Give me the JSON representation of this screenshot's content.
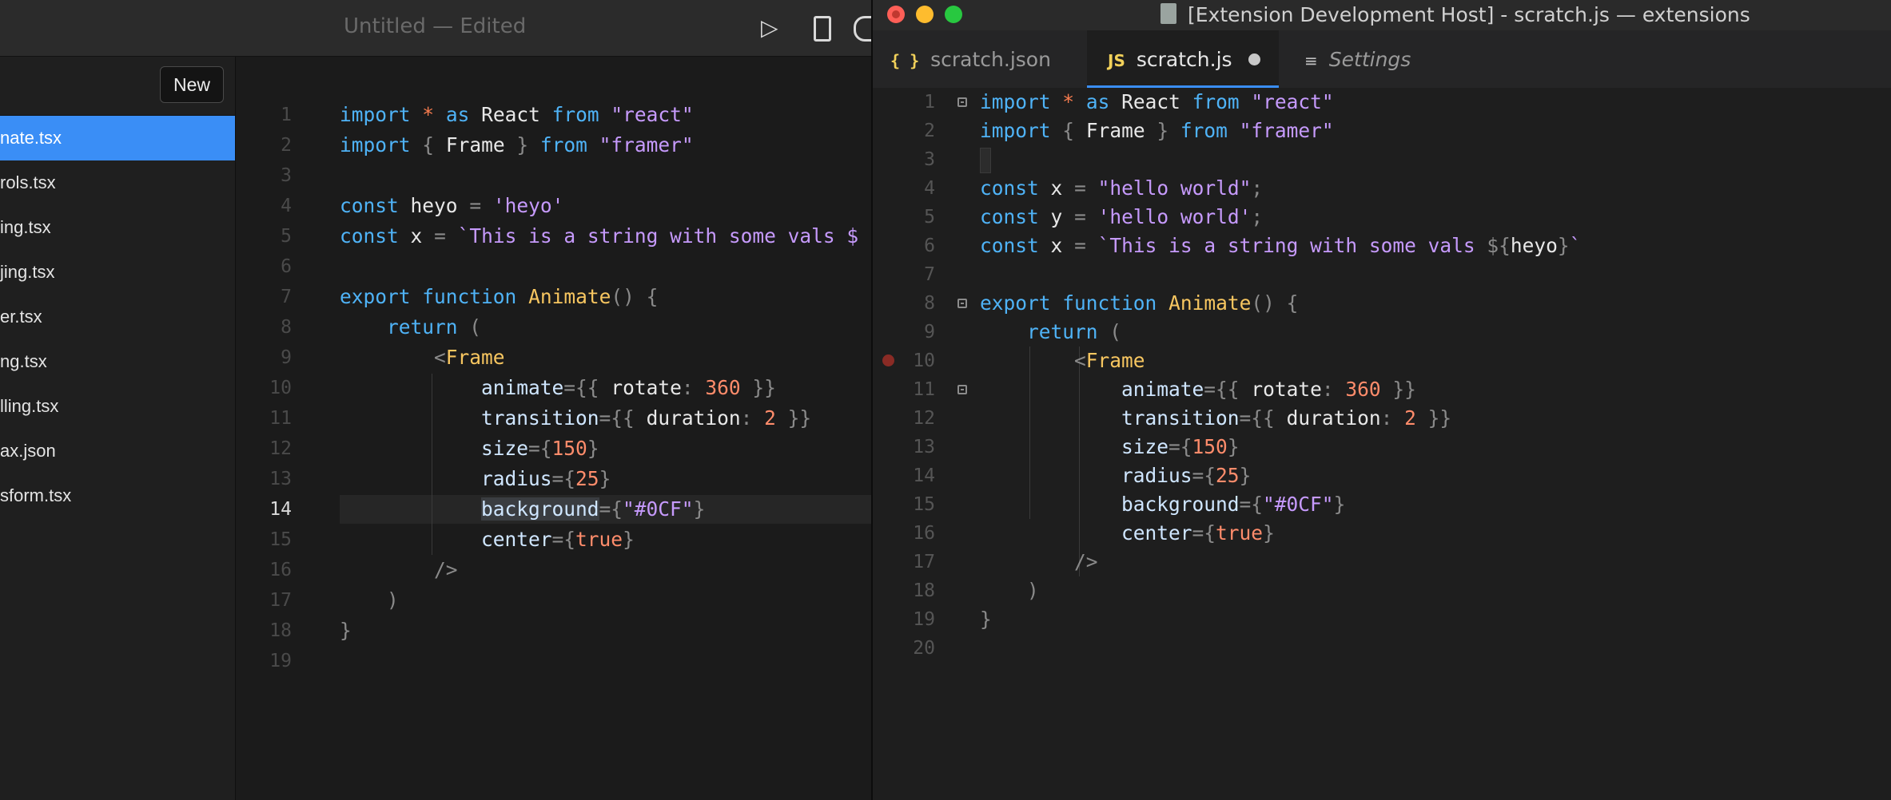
{
  "left_window": {
    "title": "Untitled — Edited",
    "new_button": "New",
    "files": [
      {
        "name": "nate.tsx",
        "active": true
      },
      {
        "name": "rols.tsx",
        "active": false
      },
      {
        "name": "ing.tsx",
        "active": false
      },
      {
        "name": "jing.tsx",
        "active": false
      },
      {
        "name": "er.tsx",
        "active": false
      },
      {
        "name": "ng.tsx",
        "active": false
      },
      {
        "name": "lling.tsx",
        "active": false
      },
      {
        "name": "ax.json",
        "active": false
      },
      {
        "name": "sform.tsx",
        "active": false
      }
    ],
    "current_line": 14,
    "line_numbers": [
      "1",
      "2",
      "3",
      "4",
      "5",
      "6",
      "7",
      "8",
      "9",
      "10",
      "11",
      "12",
      "13",
      "14",
      "15",
      "16",
      "17",
      "18",
      "19"
    ]
  },
  "right_window": {
    "title": "[Extension Development Host] - scratch.js — extensions",
    "tabs": [
      {
        "icon": "{ }",
        "label": "scratch.json"
      },
      {
        "icon": "JS",
        "label": "scratch.js"
      },
      {
        "icon": "settings-icon",
        "label": "Settings"
      }
    ],
    "line_numbers": [
      "1",
      "2",
      "3",
      "4",
      "5",
      "6",
      "7",
      "8",
      "9",
      "10",
      "11",
      "12",
      "13",
      "14",
      "15",
      "16",
      "17",
      "18",
      "19",
      "20"
    ],
    "breakpoint_line": 10
  },
  "colors": {
    "keyword": "#4fb3f7",
    "string": "#c69afc",
    "function": "#f7c660",
    "number": "#ff8c6b",
    "selected_file": "#3a8ef6"
  }
}
